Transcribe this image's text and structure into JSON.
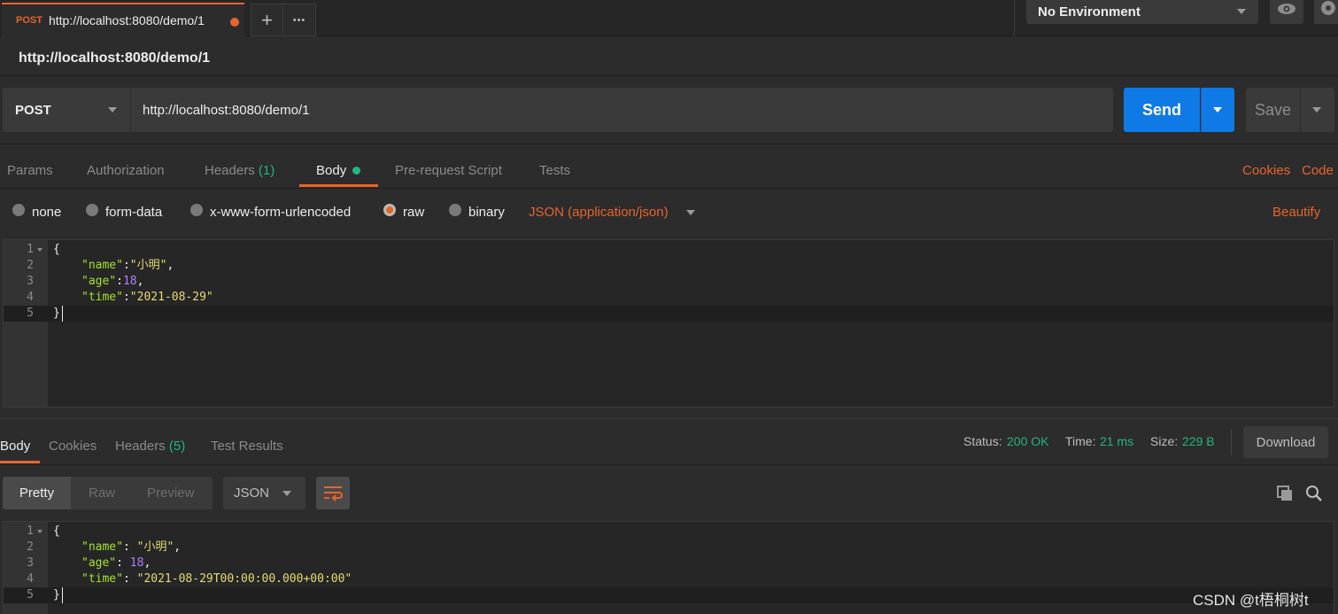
{
  "tabs": {
    "active": {
      "method": "POST",
      "url": "http://localhost:8080/demo/1"
    },
    "add_label": "+",
    "more_label": "•••"
  },
  "environment": {
    "label": "No Environment"
  },
  "request": {
    "title": "http://localhost:8080/demo/1",
    "method": "POST",
    "url": "http://localhost:8080/demo/1",
    "send_label": "Send",
    "save_label": "Save"
  },
  "request_tabs": {
    "params": "Params",
    "authorization": "Authorization",
    "headers": "Headers",
    "headers_count": "(1)",
    "body": "Body",
    "prerequest": "Pre-request Script",
    "tests": "Tests",
    "cookies": "Cookies",
    "code": "Code"
  },
  "body_options": {
    "none": "none",
    "form_data": "form-data",
    "urlencoded": "x-www-form-urlencoded",
    "raw": "raw",
    "binary": "binary",
    "content_type": "JSON (application/json)",
    "beautify": "Beautify"
  },
  "request_body": {
    "line_numbers": [
      "1",
      "2",
      "3",
      "4",
      "5"
    ],
    "open": "{",
    "close": "}",
    "lines": [
      {
        "key": "\"name\"",
        "sep": ":",
        "value": "\"小明\"",
        "end": ","
      },
      {
        "key": "\"age\"",
        "sep": ":",
        "value": "18",
        "end": ","
      },
      {
        "key": "\"time\"",
        "sep": ":",
        "value": "\"2021-08-29\"",
        "end": ""
      }
    ]
  },
  "response_tabs": {
    "body": "Body",
    "cookies": "Cookies",
    "headers": "Headers",
    "headers_count": "(5)",
    "test_results": "Test Results"
  },
  "response_meta": {
    "status_label": "Status:",
    "status_value": "200 OK",
    "time_label": "Time:",
    "time_value": "21 ms",
    "size_label": "Size:",
    "size_value": "229 B",
    "download_label": "Download"
  },
  "response_view": {
    "pretty": "Pretty",
    "raw": "Raw",
    "preview": "Preview",
    "format": "JSON"
  },
  "response_body": {
    "line_numbers": [
      "1",
      "2",
      "3",
      "4",
      "5"
    ],
    "open": "{",
    "close": "}",
    "lines": [
      {
        "key": "\"name\"",
        "sep": ": ",
        "value": "\"小明\"",
        "end": ","
      },
      {
        "key": "\"age\"",
        "sep": ": ",
        "value": "18",
        "end": ","
      },
      {
        "key": "\"time\"",
        "sep": ": ",
        "value": "\"2021-08-29T00:00:00.000+00:00\"",
        "end": ""
      }
    ]
  },
  "watermark": "CSDN @t梧桐树t",
  "colors": {
    "accent": "#e8642c",
    "send": "#0f7ae5",
    "success": "#26b47f"
  }
}
